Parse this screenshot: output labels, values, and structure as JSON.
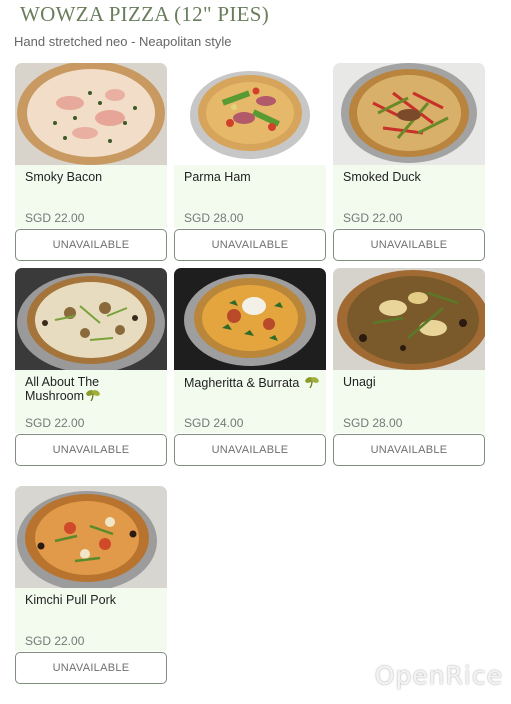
{
  "header": {
    "title": "WOWZA PIZZA (12\" PIES)",
    "subtitle": "Hand stretched neo - Neapolitan style"
  },
  "items": [
    {
      "name": "Smoky Bacon",
      "price": "SGD 22.00",
      "button": "UNAVAILABLE",
      "vegetarian": false
    },
    {
      "name": "Parma Ham",
      "price": "SGD 28.00",
      "button": "UNAVAILABLE",
      "vegetarian": false
    },
    {
      "name": "Smoked Duck",
      "price": "SGD 22.00",
      "button": "UNAVAILABLE",
      "vegetarian": false
    },
    {
      "name": "All About The Mushroom",
      "price": "SGD 22.00",
      "button": "UNAVAILABLE",
      "vegetarian": true
    },
    {
      "name": "Magheritta & Burrata",
      "price": "SGD 24.00",
      "button": "UNAVAILABLE",
      "vegetarian": true
    },
    {
      "name": "Unagi",
      "price": "SGD 28.00",
      "button": "UNAVAILABLE",
      "vegetarian": false
    },
    {
      "name": "Kimchi Pull Pork",
      "price": "SGD 22.00",
      "button": "UNAVAILABLE",
      "vegetarian": false
    }
  ],
  "watermark": "OpenRice",
  "colors": {
    "title": "#6a7d5c",
    "card_info_bg": "#f3fbef",
    "button_border": "#7f8f7f",
    "vegetarian_leaf": "#8a9a2a"
  }
}
